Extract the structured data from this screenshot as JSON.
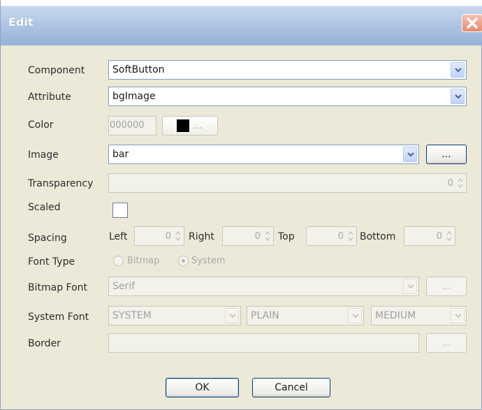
{
  "window": {
    "title": "Edit"
  },
  "labels": {
    "component": "Component",
    "attribute": "Attribute",
    "color": "Color",
    "image": "Image",
    "transparency": "Transparency",
    "scaled": "Scaled",
    "spacing": "Spacing",
    "font_type": "Font Type",
    "bitmap_font": "Bitmap Font",
    "system_font": "System Font",
    "border": "Border"
  },
  "fields": {
    "component": "SoftButton",
    "attribute": "bgImage",
    "color_hex": "000000",
    "color_button": "...",
    "image": "bar",
    "image_browse": "...",
    "transparency": "0",
    "bitmap_font": "Serif",
    "bitmap_font_browse": "...",
    "system_font_face": "SYSTEM",
    "system_font_style": "PLAIN",
    "system_font_size": "MEDIUM",
    "border": "",
    "border_browse": "..."
  },
  "spacing": {
    "left_label": "Left",
    "left": "0",
    "right_label": "Right",
    "right": "0",
    "top_label": "Top",
    "top": "0",
    "bottom_label": "Bottom",
    "bottom": "0"
  },
  "font_type": {
    "bitmap": "Bitmap",
    "system": "System",
    "selected": "System"
  },
  "buttons": {
    "ok": "OK",
    "cancel": "Cancel"
  },
  "colors": {
    "swatch": "#000000",
    "title_bar": "#96b0d8",
    "dialog_bg": "#ece9d8"
  }
}
